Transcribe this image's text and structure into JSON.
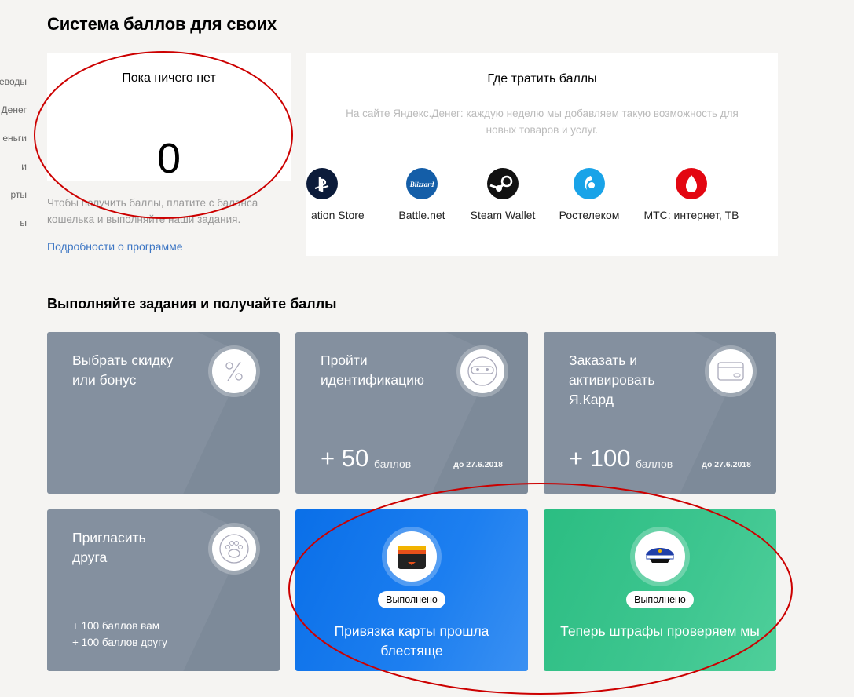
{
  "sidebar": {
    "items": [
      "еводы",
      "Денег",
      "еньги",
      "и",
      "рты",
      "ы"
    ]
  },
  "page": {
    "title": "Система баллов для своих"
  },
  "balance": {
    "label": "Пока ничего нет",
    "value": "0",
    "hint": "Чтобы получить баллы, платите с баланса кошелька и выполняйте наши задания.",
    "link": "Подробности о программе"
  },
  "spend": {
    "title": "Где тратить баллы",
    "description": "На сайте Яндекс.Денег: каждую неделю мы добавляем такую возможность для новых товаров и услуг.",
    "partners": [
      {
        "name": "ation Store",
        "icon": "playstation-icon",
        "color": "#0b1b3a"
      },
      {
        "name": "Battle.net",
        "icon": "blizzard-icon",
        "color": "#145ea8"
      },
      {
        "name": "Steam Wallet",
        "icon": "steam-icon",
        "color": "#111111"
      },
      {
        "name": "Ростелеком",
        "icon": "rostelecom-icon",
        "color": "#19a3e8"
      },
      {
        "name": "МТС: интернет, ТВ",
        "icon": "mts-icon",
        "color": "#e30611"
      }
    ]
  },
  "tasks": {
    "title": "Выполняйте задания и получайте баллы",
    "discount": {
      "title": "Выбрать скидку или бонус",
      "icon": "percent-icon"
    },
    "identify": {
      "title": "Пройти идентификацию",
      "points": "+ 50",
      "units": "баллов",
      "deadline": "до 27.6.2018",
      "icon": "mask-icon"
    },
    "card": {
      "title": "Заказать и активировать Я.Кард",
      "points": "+ 100",
      "units": "баллов",
      "deadline": "до 27.6.2018",
      "icon": "card-icon"
    },
    "invite": {
      "title": "Пригласить друга",
      "line1": "+ 100 баллов вам",
      "line2": "+ 100 баллов другу",
      "icon": "paw-icon"
    },
    "bind": {
      "badge": "Выполнено",
      "text": "Привязка карты прошла блестяще",
      "icon": "wallet-icon"
    },
    "fines": {
      "badge": "Выполнено",
      "text": "Теперь штрафы проверяем мы",
      "icon": "police-cap-icon"
    }
  },
  "colors": {
    "accent_link": "#3d76c4",
    "task_gray": "#7d8a99",
    "task_blue": "#0a6fe8",
    "task_green": "#2bbd82",
    "annotation": "#cc0000"
  }
}
